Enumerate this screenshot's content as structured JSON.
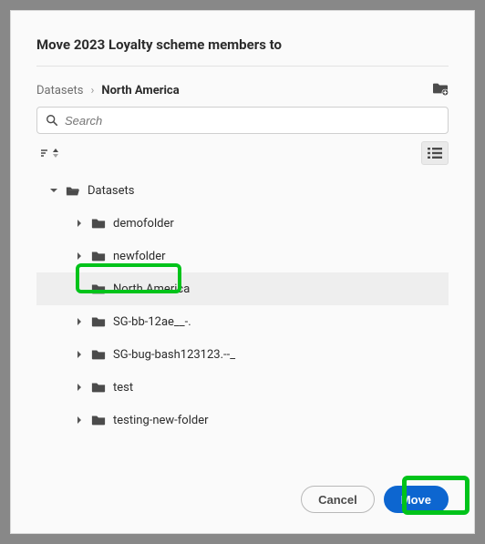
{
  "title": "Move 2023 Loyalty scheme members to",
  "breadcrumb": {
    "root": "Datasets",
    "sep": "›",
    "current": "North America"
  },
  "search": {
    "placeholder": "Search"
  },
  "tree": {
    "root": "Datasets",
    "items": [
      {
        "label": "demofolder"
      },
      {
        "label": "newfolder"
      },
      {
        "label": "North America"
      },
      {
        "label": "SG-bb-12ae__-."
      },
      {
        "label": "SG-bug-bash123123.--_"
      },
      {
        "label": "test"
      },
      {
        "label": "testing-new-folder"
      }
    ],
    "selected_index": 2
  },
  "buttons": {
    "cancel": "Cancel",
    "move": "Move"
  }
}
